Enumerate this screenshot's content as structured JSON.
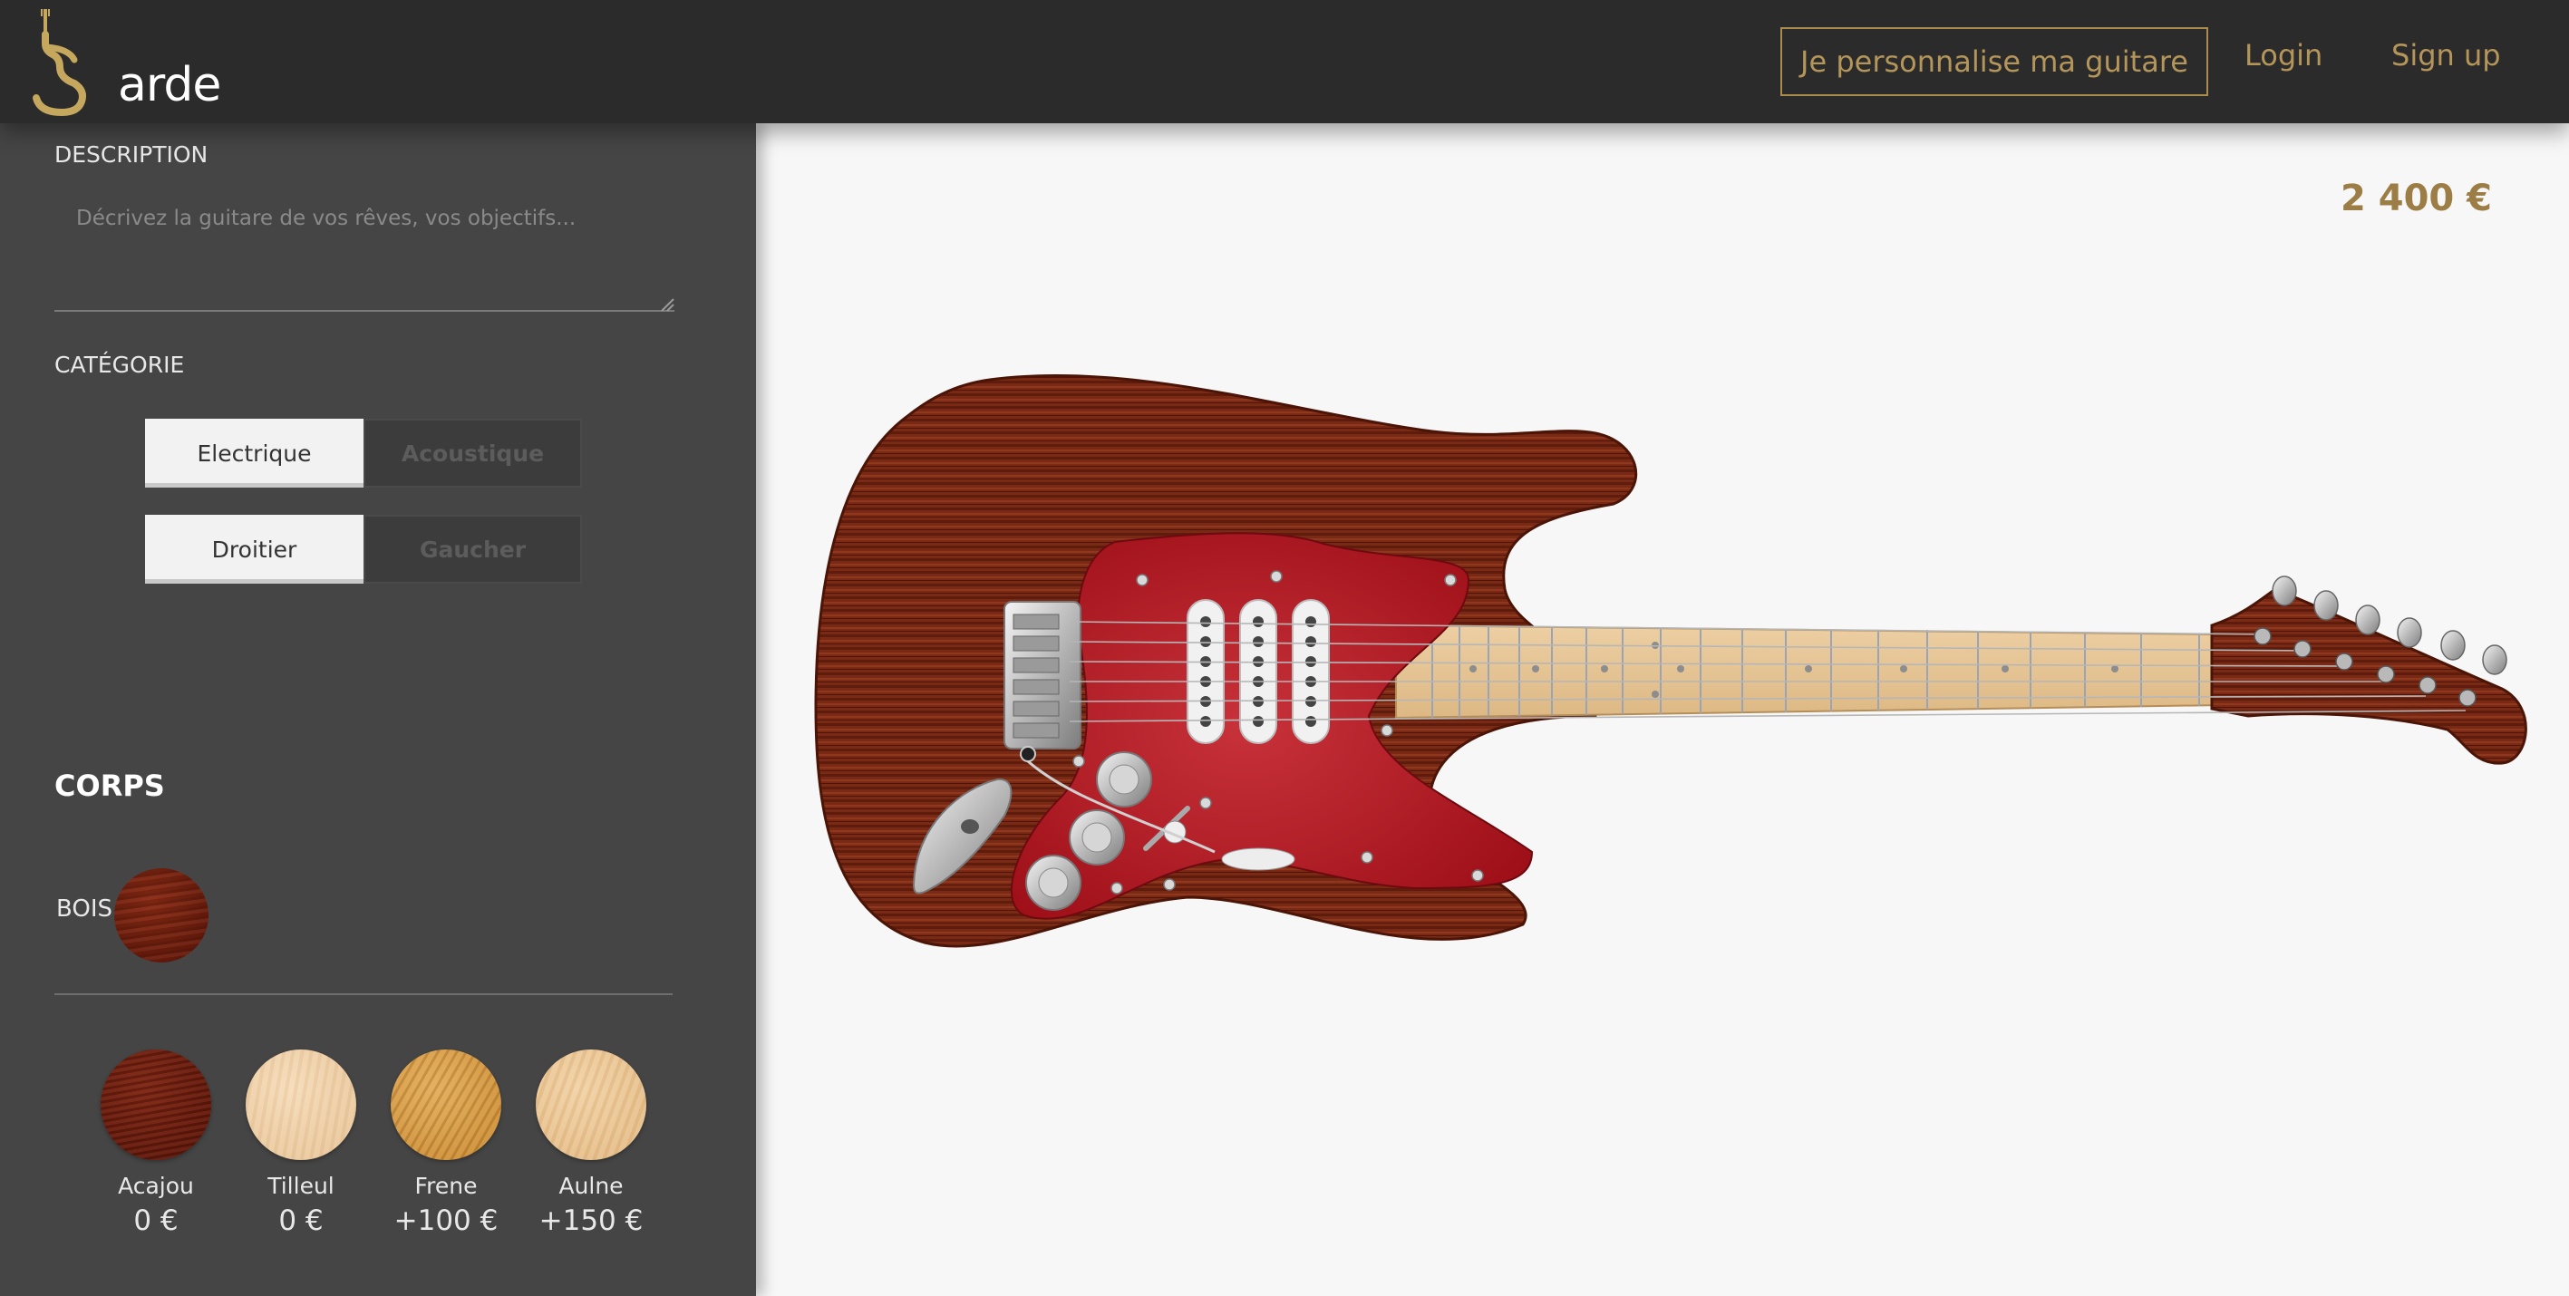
{
  "header": {
    "logo_text": "arde",
    "cta_label": "Je personnalise ma guitare",
    "login_label": "Login",
    "signup_label": "Sign up"
  },
  "sidebar": {
    "description_label": "DESCRIPTION",
    "description_placeholder": "Décrivez la guitare de vos rêves, vos objectifs...",
    "category_label": "CATÉGORIE",
    "category_toggle": {
      "selected": "Electrique",
      "other": "Acoustique"
    },
    "hand_toggle": {
      "selected": "Droitier",
      "other": "Gaucher"
    },
    "section_title": "CORPS",
    "wood_label": "BOIS",
    "woods": [
      {
        "name": "Acajou",
        "price": "0 €",
        "color": "#6a1c0c"
      },
      {
        "name": "Tilleul",
        "price": "0 €",
        "color": "#efd2ad"
      },
      {
        "name": "Frene",
        "price": "+100 €",
        "color": "#d49a48"
      },
      {
        "name": "Aulne",
        "price": "+150 €",
        "color": "#ecc99a"
      }
    ]
  },
  "main": {
    "total_price": "2 400 €"
  },
  "colors": {
    "header_bg": "#2b2b2b",
    "sidebar_bg": "#454545",
    "accent_gold": "#b4955a",
    "body_wood": "#7a2a16",
    "pickguard": "#b0141e",
    "fretboard": "#e6c699"
  }
}
